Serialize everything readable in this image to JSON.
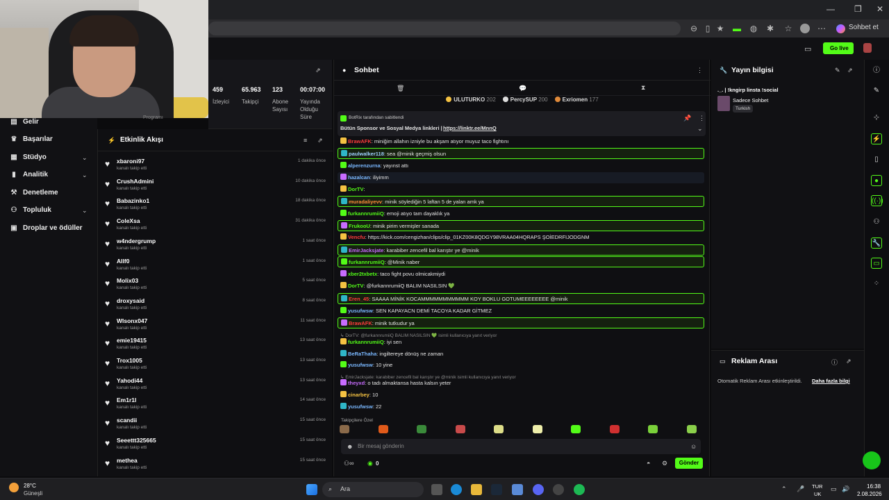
{
  "browser": {
    "extension_label": "Sohbet et"
  },
  "header": {
    "go_live": "Go live"
  },
  "nav": [
    {
      "label": "Gelir",
      "icon": "revenue-icon",
      "glyph": "▤"
    },
    {
      "label": "Başarılar",
      "icon": "trophy-icon",
      "glyph": "♛"
    },
    {
      "label": "Stüdyo",
      "icon": "studio-icon",
      "glyph": "▦"
    },
    {
      "label": "Analitik",
      "icon": "analytics-icon",
      "glyph": "▮"
    },
    {
      "label": "Denetleme",
      "icon": "moderation-icon",
      "glyph": "⚒"
    },
    {
      "label": "Topluluk",
      "icon": "community-icon",
      "glyph": "⚇"
    },
    {
      "label": "Droplar ve ödüller",
      "icon": "drops-icon",
      "glyph": "▣"
    }
  ],
  "stats": [
    {
      "value": "459",
      "label": "İzleyici"
    },
    {
      "value": "65.963",
      "label": "Takipçi"
    },
    {
      "value": "123",
      "label": "Abone Sayısı"
    },
    {
      "value": "00:07:00",
      "label": "Yayında Olduğu Süre"
    }
  ],
  "stats_program": "Programı",
  "activity": {
    "title": "Etkinlik Akışı",
    "items": [
      {
        "name": "xbaroni97",
        "sub": "kanalı takip etti",
        "time": "1 dakika önce"
      },
      {
        "name": "CrushAdmini",
        "sub": "kanalı takip etti",
        "time": "10 dakika önce"
      },
      {
        "name": "Babazinko1",
        "sub": "kanalı takip etti",
        "time": "18 dakika önce"
      },
      {
        "name": "ColeXsa",
        "sub": "kanalı takip etti",
        "time": "31 dakika önce"
      },
      {
        "name": "w4ndergrump",
        "sub": "kanalı takip etti",
        "time": "1 saat önce"
      },
      {
        "name": "Allf0",
        "sub": "kanalı takip etti",
        "time": "1 saat önce"
      },
      {
        "name": "Molix03",
        "sub": "kanalı takip etti",
        "time": "5 saat önce"
      },
      {
        "name": "droxysaid",
        "sub": "kanalı takip etti",
        "time": "8 saat önce"
      },
      {
        "name": "Wlsonx047",
        "sub": "kanalı takip etti",
        "time": "11 saat önce"
      },
      {
        "name": "emie19415",
        "sub": "kanalı takip etti",
        "time": "13 saat önce"
      },
      {
        "name": "Trox1005",
        "sub": "kanalı takip etti",
        "time": "13 saat önce"
      },
      {
        "name": "Yahodi44",
        "sub": "kanalı takip etti",
        "time": "13 saat önce"
      },
      {
        "name": "Em1r1l",
        "sub": "kanalı takip etti",
        "time": "14 saat önce"
      },
      {
        "name": "scandii",
        "sub": "kanalı takip etti",
        "time": "15 saat önce"
      },
      {
        "name": "Seeettt325665",
        "sub": "kanalı takip etti",
        "time": "15 saat önce"
      },
      {
        "name": "methea",
        "sub": "kanalı takip etti",
        "time": "15 saat önce"
      }
    ]
  },
  "chat": {
    "title": "Sohbet",
    "gifters": [
      {
        "name": "ULUTURKO",
        "count": "202",
        "color": "#f5c242"
      },
      {
        "name": "PercySUP",
        "count": "200",
        "color": "#dddddd"
      },
      {
        "name": "Exriomen",
        "count": "177",
        "color": "#e08a3a"
      }
    ],
    "pinned_by": "BotRix tarafından sabitlendi",
    "pinned_text": "Bütün Sponsor ve Sosyal Medya linkleri |",
    "pinned_link": "https://linktr.ee/MnnQ",
    "messages": [
      {
        "user": "BrawAFK",
        "color": "#ff3b3b",
        "text": ": miniğim allahın izniyle bu akşam atıyor muyuz taco fightını",
        "style": ""
      },
      {
        "user": "paulwalker118",
        "color": "#9fd0ff",
        "text": ": sea @minik geçmiş olsun",
        "style": "hl"
      },
      {
        "user": "alperenzurna",
        "color": "#7ab8ff",
        "text": ": yayınst attı",
        "style": ""
      },
      {
        "user": "hazalcan",
        "color": "#7ab8ff",
        "text": ": iliyimm",
        "style": "alt"
      },
      {
        "user": "DorTV",
        "color": "#53fc18",
        "text": ":",
        "style": ""
      },
      {
        "user": "muradaliyevv",
        "color": "#ff8c3a",
        "text": ": minik söylediğin 5 laftan 5 de yalan amk ya",
        "style": "hl"
      },
      {
        "user": "furkannrumiiQ",
        "color": "#53fc18",
        "text": ": emoji atıyo tam dayaklık ya",
        "style": ""
      },
      {
        "user": "FrukooU",
        "color": "#53fc18",
        "text": ": minik pirim vermişler sanada",
        "style": "hl"
      },
      {
        "user": "Vencfu",
        "color": "#ff3b3b",
        "text": ": https://kick.com/cengizhan/clips/clip_01KZ00K8QDGY98VRAA04HQRAPS ŞOİEDRFIJODGNM",
        "style": ""
      },
      {
        "user": "EmirJacksjate",
        "color": "#c86cff",
        "text": ": karabiber zencefil bal karıştır ye @minik",
        "style": "hl"
      },
      {
        "user": "furkannrumiiQ",
        "color": "#53fc18",
        "text": ": @Minik naber",
        "style": "hl"
      },
      {
        "user": "xber2txbetx",
        "color": "#53fc18",
        "text": ": taco fight povu olmicakmiydi",
        "style": ""
      },
      {
        "user": "DorTV",
        "color": "#53fc18",
        "text": ": @furkannrumiiQ BALIM NASILSIN 💚",
        "style": ""
      },
      {
        "user": "Eren_45",
        "color": "#ff3b3b",
        "text": ": SAAAA MİNİK KOCAMMMMMMMMMMM KOY BOKLU GOTUMEEEEEEEE @minik",
        "style": "hl"
      },
      {
        "user": "yusufwsw",
        "color": "#7ab8ff",
        "text": ": SEN KAPAYACN DEMİ TACOYA KADAR GİTMEZ",
        "style": ""
      },
      {
        "user": "BrawAFK",
        "color": "#ff3b3b",
        "text": ": minik tutkudur ya",
        "style": "hl"
      },
      {
        "user": "furkannrumiiQ",
        "color": "#53fc18",
        "text": ": iyi sen",
        "style": ""
      },
      {
        "user": "BeRaThaha",
        "color": "#7ab8ff",
        "text": ": ingiltereye dönüş ne zaman",
        "style": ""
      },
      {
        "user": "yusufwsw",
        "color": "#7ab8ff",
        "text": ": 10 yine",
        "style": ""
      },
      {
        "user": "theyxd",
        "color": "#c86cff",
        "text": ": o tadı almaktansa hasta kalsın yeter",
        "style": ""
      },
      {
        "user": "cinarbey",
        "color": "#f5c242",
        "text": ": 10",
        "style": ""
      },
      {
        "user": "yusufwsw",
        "color": "#7ab8ff",
        "text": ": 22",
        "style": ""
      }
    ],
    "replies": [
      {
        "text": "↳ DorTV: @furkannrumiiQ BALIM NASILSIN 💚 isimli kullanıcıya yanıt veriyor"
      },
      {
        "text": "↳ EmirJacksjate: karabiber zencefil bal karıştır ye @minik isimli kullanıcıya yanıt veriyor"
      }
    ],
    "emote_section": "Takipçilere Özel",
    "input_placeholder": "Bir mesaj gönderin",
    "points": "0",
    "send_label": "Gönder"
  },
  "stream_info": {
    "title": "Yayın bilgisi",
    "stream_title": "._. | !kngirp linsta !social",
    "category": "Sadece Sohbet",
    "language": "Turkish"
  },
  "ad_break": {
    "title": "Reklam Arası",
    "text": "Otomatik Reklam Arası etkinleştirildi.",
    "link": "Daha fazla bilgi"
  },
  "taskbar": {
    "weather_temp": "28°C",
    "weather_desc": "Güneşli",
    "search": "Ara",
    "lang1": "TUR",
    "lang2": "UK",
    "time": "16:38",
    "date": "2.08.2026"
  },
  "colors": {
    "accent": "#53fc18",
    "bg": "#0f0f12"
  }
}
